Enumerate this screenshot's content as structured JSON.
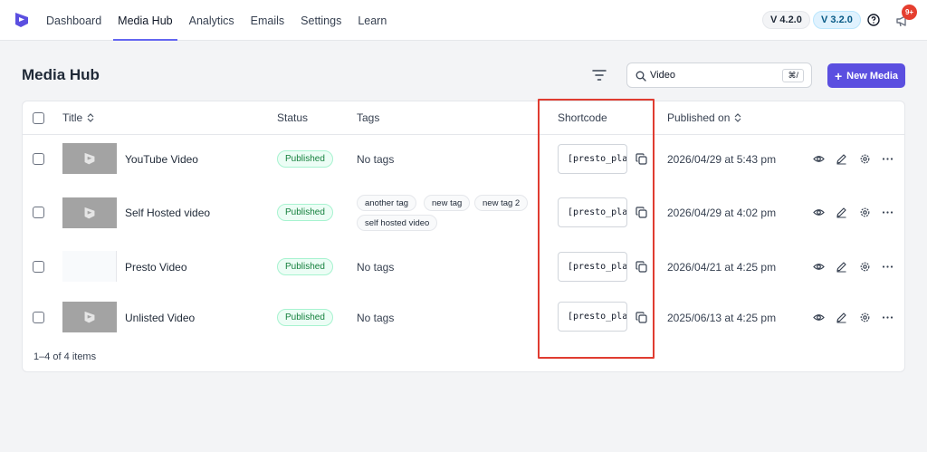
{
  "nav": {
    "items": [
      {
        "label": "Dashboard",
        "active": false
      },
      {
        "label": "Media Hub",
        "active": true
      },
      {
        "label": "Analytics",
        "active": false
      },
      {
        "label": "Emails",
        "active": false
      },
      {
        "label": "Settings",
        "active": false
      },
      {
        "label": "Learn",
        "active": false
      }
    ],
    "version_a": "V 4.2.0",
    "version_b": "V 3.2.0",
    "notification_count": "9+"
  },
  "page": {
    "title": "Media Hub",
    "search_value": "Video",
    "search_shortcut": "⌘/",
    "new_button": "New Media"
  },
  "table": {
    "headers": {
      "title": "Title",
      "status": "Status",
      "tags": "Tags",
      "shortcode": "Shortcode",
      "published": "Published on"
    },
    "rows": [
      {
        "title": "YouTube Video",
        "status": "Published",
        "tags": [],
        "no_tags": "No tags",
        "shortcode": "[presto_player id=",
        "date": "2026/04/29 at 5:43 pm",
        "thumb": "logo"
      },
      {
        "title": "Self Hosted video",
        "status": "Published",
        "tags": [
          "another tag",
          "new tag",
          "new tag 2",
          "self hosted video"
        ],
        "no_tags": "",
        "shortcode": "[presto_player id=",
        "date": "2026/04/29 at 4:02 pm",
        "thumb": "logo"
      },
      {
        "title": "Presto Video",
        "status": "Published",
        "tags": [],
        "no_tags": "No tags",
        "shortcode": "[presto_player id=",
        "date": "2026/04/21 at 4:25 pm",
        "thumb": "blank"
      },
      {
        "title": "Unlisted Video",
        "status": "Published",
        "tags": [],
        "no_tags": "No tags",
        "shortcode": "[presto_player id=",
        "date": "2025/06/13 at 4:25 pm",
        "thumb": "logo"
      }
    ],
    "footer": "1–4 of 4 items"
  },
  "colors": {
    "accent": "#5b4fe0",
    "highlight": "#e03c31",
    "status_green": "#15803d"
  }
}
